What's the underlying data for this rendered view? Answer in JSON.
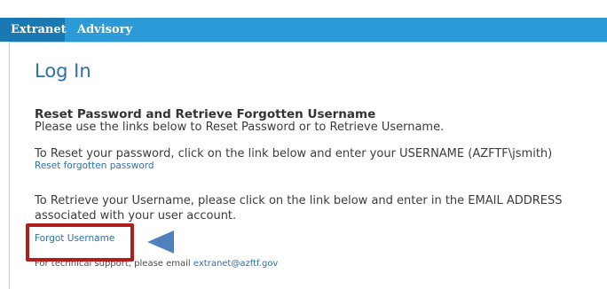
{
  "nav": {
    "tabs": [
      {
        "label": "Extranet",
        "active": true
      },
      {
        "label": "Advisory",
        "active": false
      }
    ]
  },
  "login": {
    "title": "Log In",
    "heading": "Reset Password and Retrieve Forgotten Username",
    "intro": "Please use the links below to Reset Password or to Retrieve Username.",
    "reset_instructions": "To Reset your password, click on the link below and enter your USERNAME (AZFTF\\jsmith)",
    "reset_link": "Reset forgotten password",
    "retrieve_instructions_line1": "To Retrieve your Username, please click on the link below and enter in the EMAIL ADDRESS",
    "retrieve_instructions_line2": "associated with your user account.",
    "forgot_link": "Forgot Username",
    "support_text": "For technical support, please email",
    "support_email": "extranet@azftf.gov"
  },
  "colors": {
    "nav_bar": "#2d9ad8",
    "nav_active": "#1a78b3",
    "title": "#2f6fae",
    "link": "#2f6fae",
    "highlight_box": "#b01e1e",
    "arrow": "#4f81bd"
  }
}
